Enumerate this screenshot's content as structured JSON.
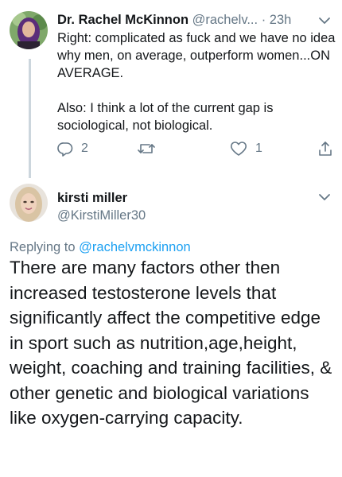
{
  "tweet1": {
    "display_name": "Dr. Rachel McKinnon",
    "handle": "@rachelv...",
    "separator": "·",
    "time": "23h",
    "body_p1": "Right: complicated as fuck and we have no idea why men, on average, outperform women...ON AVERAGE.",
    "body_p2": "Also: I think a lot of the current gap is sociological, not biological.",
    "reply_count": "2",
    "retweet_count": "",
    "like_count": "1"
  },
  "tweet2": {
    "display_name": "kirsti miller",
    "handle": "@KirstiMiller30",
    "replying_prefix": "Replying to",
    "replying_handle": "@rachelvmckinnon",
    "body": "There are many factors other then increased testosterone levels that significantly affect the competitive edge in sport such as nutrition,age,height, weight, coaching and training facilities, & other genetic and biological variations like oxygen-carrying capacity."
  },
  "colors": {
    "text": "#14171a",
    "secondary": "#657786",
    "accent": "#1da1f2",
    "thread_line": "#ccd6dd"
  },
  "icons": [
    "reply-icon",
    "retweet-icon",
    "like-icon",
    "share-icon",
    "chevron-down-icon"
  ]
}
